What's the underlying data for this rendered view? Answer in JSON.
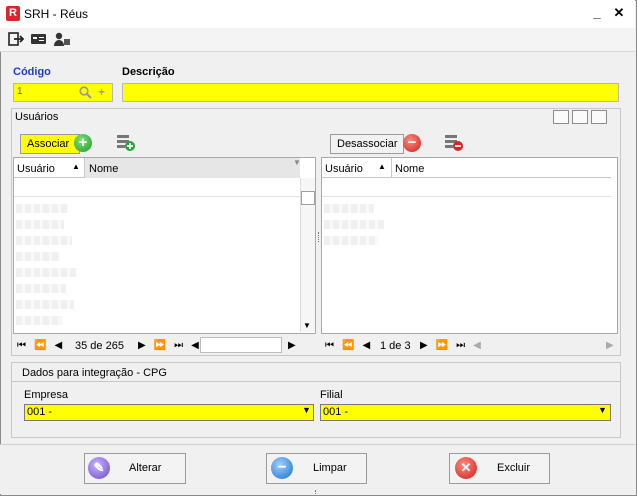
{
  "window": {
    "title": "SRH - Réus",
    "app_icon_letter": "R",
    "minimize_glyph": "_",
    "close_glyph": "✕"
  },
  "toolbar": {
    "icons": [
      "exit-icon",
      "card-icon",
      "user-key-icon"
    ]
  },
  "form": {
    "codigo_label": "Código",
    "codigo_value": "1",
    "descricao_label": "Descrição",
    "descricao_value": ""
  },
  "usuarios": {
    "group_title": "Usuários",
    "left": {
      "button_label": "Associar",
      "col_usuario": "Usuário",
      "col_nome": "Nome",
      "pager_text": "35 de 265"
    },
    "right": {
      "button_label": "Desassociar",
      "col_usuario": "Usuário",
      "col_nome": "Nome",
      "pager_text": "1 de 3"
    }
  },
  "integracao": {
    "group_title": "Dados para integração - CPG",
    "empresa_label": "Empresa",
    "empresa_value": "001 -",
    "filial_label": "Filial",
    "filial_value": "001 -"
  },
  "actions": {
    "alterar": "Alterar",
    "limpar": "Limpar",
    "excluir": "Excluir"
  },
  "colors": {
    "required_field": "#ffff00",
    "label_blue": "#1f3fbf"
  }
}
